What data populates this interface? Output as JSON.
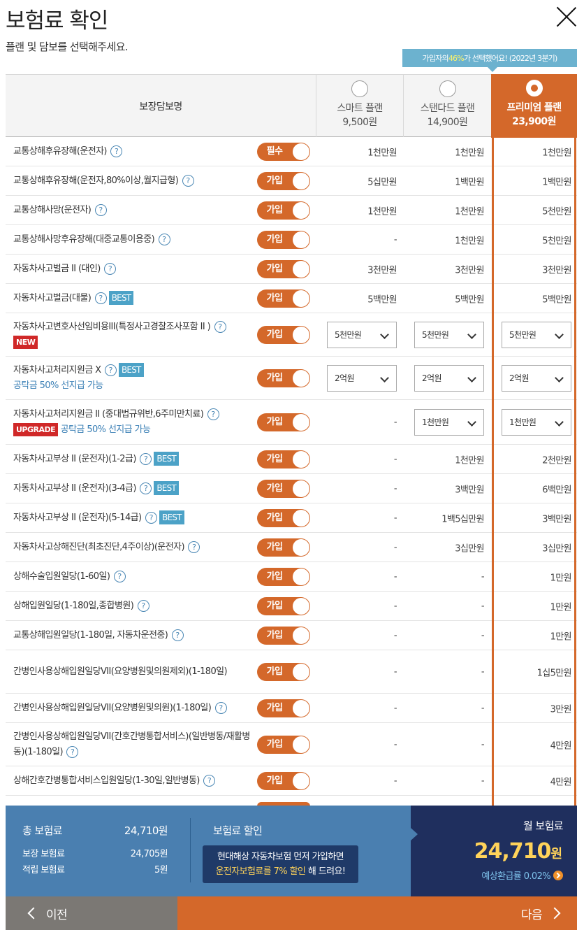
{
  "page": {
    "title": "보험료 확인",
    "subtitle": "플랜 및 담보를 선택해주세요.",
    "tip_prefix": "가입자의 ",
    "tip_highlight": "46%",
    "tip_suffix": "가 선택했어요!  (2022년 3분기)"
  },
  "header": {
    "coverage_col": "보장담보명",
    "plans": [
      {
        "name": "스마트 플랜",
        "price": "9,500원",
        "selected": false
      },
      {
        "name": "스탠다드 플랜",
        "price": "14,900원",
        "selected": false
      },
      {
        "name": "프리미엄 플랜",
        "price": "23,900원",
        "selected": true
      }
    ]
  },
  "rows": [
    {
      "name": "교통상해후유장해(운전자)",
      "badge": "",
      "sub": "",
      "toggle": "필수",
      "values": [
        "1천만원",
        "1천만원",
        "1천만원"
      ]
    },
    {
      "name": "교통상해후유장해(운전자,80%이상,월지급형)",
      "badge": "",
      "sub": "",
      "toggle": "가입",
      "values": [
        "5십만원",
        "1백만원",
        "1백만원"
      ]
    },
    {
      "name": "교통상해사망(운전자)",
      "badge": "",
      "sub": "",
      "toggle": "가입",
      "values": [
        "1천만원",
        "1천만원",
        "5천만원"
      ]
    },
    {
      "name": "교통상해사망후유장해(대중교통이용중)",
      "badge": "",
      "sub": "",
      "toggle": "가입",
      "values": [
        "-",
        "1천만원",
        "5천만원"
      ]
    },
    {
      "name": "자동차사고벌금 II (대인)",
      "badge": "",
      "sub": "",
      "toggle": "가입",
      "values": [
        "3천만원",
        "3천만원",
        "3천만원"
      ]
    },
    {
      "name": "자동차사고벌금(대물)",
      "badge": "BEST",
      "sub": "",
      "toggle": "가입",
      "values": [
        "5백만원",
        "5백만원",
        "5백만원"
      ]
    },
    {
      "name": "자동차사고변호사선임비용III(특정사고경찰조사포함 II )",
      "badge": "NEW",
      "sub": "",
      "toggle": "가입",
      "values": [
        "5천만원",
        "5천만원",
        "5천만원"
      ],
      "dropdown": [
        true,
        true,
        true
      ]
    },
    {
      "name": "자동차사고처리지원금 X",
      "badge": "BEST",
      "sub": "공탁금 50% 선지급 가능",
      "toggle": "가입",
      "values": [
        "2억원",
        "2억원",
        "2억원"
      ],
      "dropdown": [
        true,
        true,
        true
      ]
    },
    {
      "name": "자동차사고처리지원금 II (중대법규위반,6주미만치료)",
      "badge": "UPGRADE",
      "sub": "공탁금 50% 선지급 가능",
      "toggle": "가입",
      "values": [
        "-",
        "1천만원",
        "1천만원"
      ],
      "dropdown": [
        false,
        true,
        true
      ]
    },
    {
      "name": "자동차사고부상 II (운전자)(1-2급)",
      "badge": "BEST",
      "sub": "",
      "toggle": "가입",
      "values": [
        "-",
        "1천만원",
        "2천만원"
      ]
    },
    {
      "name": "자동차사고부상 II (운전자)(3-4급)",
      "badge": "BEST",
      "sub": "",
      "toggle": "가입",
      "values": [
        "-",
        "3백만원",
        "6백만원"
      ]
    },
    {
      "name": "자동차사고부상 II (운전자)(5-14급)",
      "badge": "BEST",
      "sub": "",
      "toggle": "가입",
      "values": [
        "-",
        "1백5십만원",
        "3백만원"
      ]
    },
    {
      "name": "자동차사고상해진단(최초진단,4주이상)(운전자)",
      "badge": "",
      "sub": "",
      "toggle": "가입",
      "values": [
        "-",
        "3십만원",
        "3십만원"
      ]
    },
    {
      "name": "상해수술입원일당(1-60일)",
      "badge": "",
      "sub": "",
      "toggle": "가입",
      "values": [
        "-",
        "-",
        "1만원"
      ]
    },
    {
      "name": "상해입원일당(1-180일,종합병원)",
      "badge": "",
      "sub": "",
      "toggle": "가입",
      "values": [
        "-",
        "-",
        "1만원"
      ]
    },
    {
      "name": "교통상해입원일당(1-180일, 자동차운전중)",
      "badge": "",
      "sub": "",
      "toggle": "가입",
      "values": [
        "-",
        "-",
        "1만원"
      ]
    },
    {
      "name": "간병인사용상해입원일당VII(요양병원및의원제외)(1-180일)",
      "badge": "",
      "sub": "",
      "toggle": "가입",
      "values": [
        "-",
        "-",
        "1십5만원"
      ],
      "noq": true
    },
    {
      "name": "간병인사용상해입원일당VII(요양병원및의원)(1-180일)",
      "badge": "",
      "sub": "",
      "toggle": "가입",
      "values": [
        "-",
        "-",
        "3만원"
      ]
    },
    {
      "name": "간병인사용상해입원일당VII(간호간병통합서비스)(일반병동/재활병동)(1-180일)",
      "badge": "",
      "sub": "",
      "toggle": "가입",
      "values": [
        "-",
        "-",
        "4만원"
      ]
    },
    {
      "name": "상해간호간병통합서비스입원일당(1-30일,일반병동)",
      "badge": "",
      "sub": "",
      "toggle": "가입",
      "values": [
        "-",
        "-",
        "4만원"
      ]
    }
  ],
  "summary": {
    "total_label": "총 보험료",
    "total_value": "24,710원",
    "cover_label": "보장 보험료",
    "cover_value": "24,705원",
    "reserve_label": "적립 보험료",
    "reserve_value": "5원",
    "discount_label": "보험료 할인",
    "discount_line1": "현대해상 자동차보험 먼저 가입하면",
    "discount_line2_hl": "운전자보험료를 7% 할인",
    "discount_line2_rest": " 해 드려요!",
    "monthly_label": "월 보험료",
    "monthly_value": "24,710",
    "monthly_unit": "원",
    "refund_text": "예상환급률 0.02%"
  },
  "nav": {
    "prev": "이전",
    "next": "다음"
  },
  "colors": {
    "accent": "#d4682a",
    "summary_bg": "#4a7fb0",
    "total_bg": "#1f2f5e",
    "highlight": "#ffd35a",
    "best_badge": "#4ca2c7",
    "new_badge": "#d02828"
  }
}
